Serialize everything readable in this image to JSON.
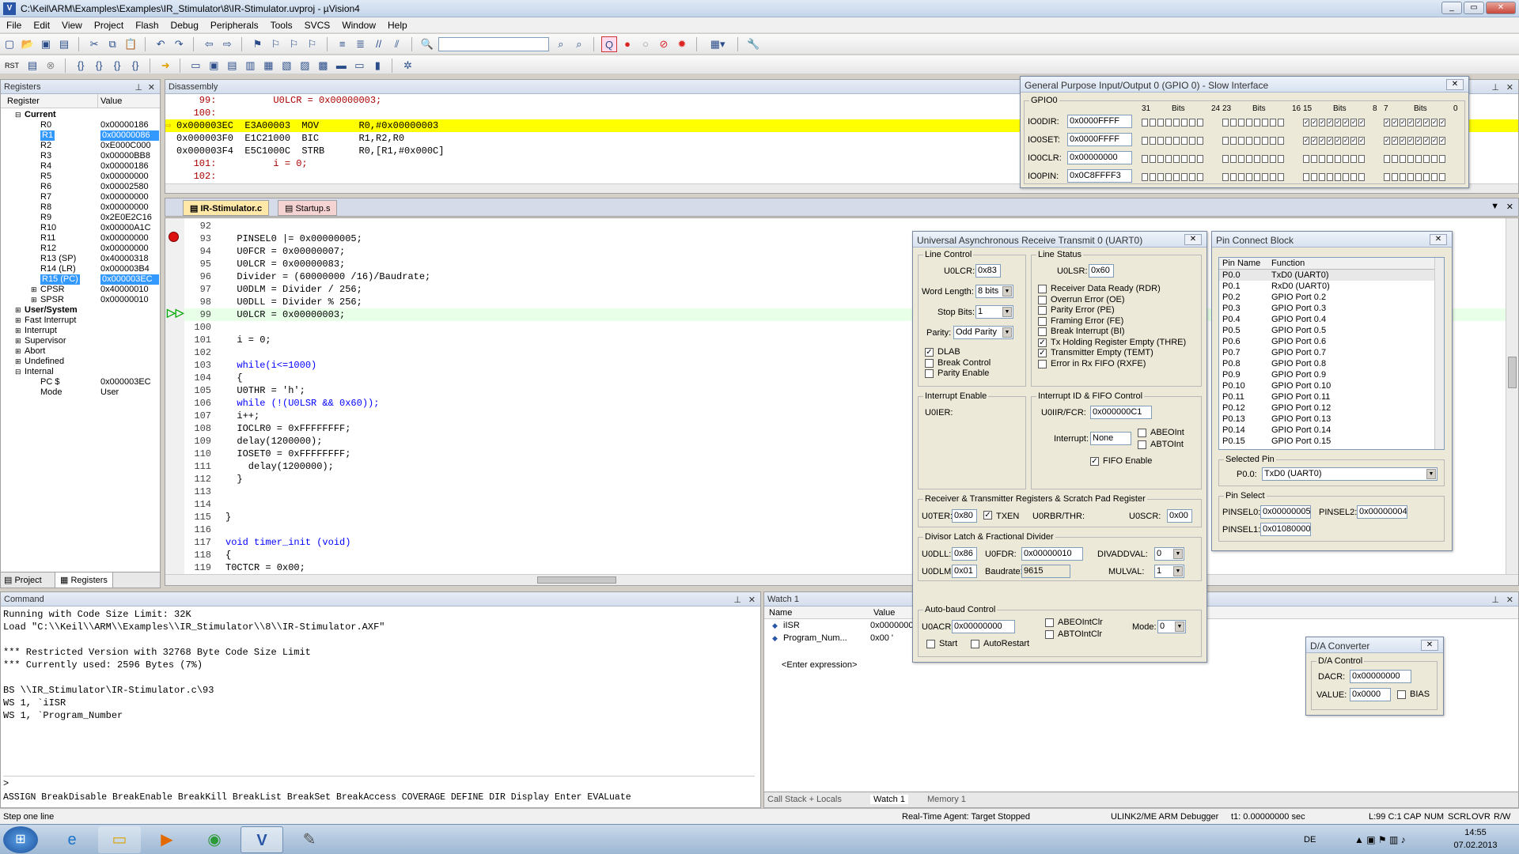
{
  "window": {
    "title": "C:\\Keil\\ARM\\Examples\\Examples\\IR_Stimulator\\8\\IR-Stimulator.uvproj - µVision4",
    "minimize": "_",
    "restore": "▭",
    "close": "✕"
  },
  "menu": [
    "File",
    "Edit",
    "View",
    "Project",
    "Flash",
    "Debug",
    "Peripherals",
    "Tools",
    "SVCS",
    "Window",
    "Help"
  ],
  "registers": {
    "title": "Registers",
    "col_register": "Register",
    "col_value": "Value",
    "current": "Current",
    "items": [
      {
        "n": "R0",
        "v": "0x00000186"
      },
      {
        "n": "R1",
        "v": "0x00000086"
      },
      {
        "n": "R2",
        "v": "0xE000C000"
      },
      {
        "n": "R3",
        "v": "0x00000BB8"
      },
      {
        "n": "R4",
        "v": "0x00000186"
      },
      {
        "n": "R5",
        "v": "0x00000000"
      },
      {
        "n": "R6",
        "v": "0x00002580"
      },
      {
        "n": "R7",
        "v": "0x00000000"
      },
      {
        "n": "R8",
        "v": "0x00000000"
      },
      {
        "n": "R9",
        "v": "0x2E0E2C16"
      },
      {
        "n": "R10",
        "v": "0x00000A1C"
      },
      {
        "n": "R11",
        "v": "0x00000000"
      },
      {
        "n": "R12",
        "v": "0x00000000"
      },
      {
        "n": "R13 (SP)",
        "v": "0x40000318"
      },
      {
        "n": "R14 (LR)",
        "v": "0x000003B4"
      },
      {
        "n": "R15 (PC)",
        "v": "0x000003EC"
      },
      {
        "n": "CPSR",
        "v": "0x40000010"
      },
      {
        "n": "SPSR",
        "v": "0x00000010"
      }
    ],
    "user_system": "User/System",
    "modes": [
      "Fast Interrupt",
      "Interrupt",
      "Supervisor",
      "Abort",
      "Undefined"
    ],
    "internal": "Internal",
    "pc_label": "PC  $",
    "pc_value": "0x000003EC",
    "mode_label": "Mode",
    "mode_value": "User",
    "tab_project": "Project",
    "tab_registers": "Registers"
  },
  "disassembly": {
    "title": "Disassembly",
    "lines": [
      "    99:          U0LCR = 0x00000003;",
      "   100:",
      "0x000003EC  E3A00003  MOV       R0,#0x00000003",
      "0x000003F0  E1C21000  BIC       R1,R2,R0",
      "0x000003F4  E5C1000C  STRB      R0,[R1,#0x000C]",
      "   101:          i = 0;",
      "   102:"
    ]
  },
  "editor": {
    "tabs": [
      "IR-Stimulator.c",
      "Startup.s"
    ],
    "lines": [
      {
        "n": "92",
        "c": ""
      },
      {
        "n": "93",
        "c": "  PINSEL0 |= 0x00000005;"
      },
      {
        "n": "94",
        "c": "  U0FCR = 0x00000007;"
      },
      {
        "n": "95",
        "c": "  U0LCR = 0x00000083;"
      },
      {
        "n": "96",
        "c": "  Divider = (60000000 /16)/Baudrate;"
      },
      {
        "n": "97",
        "c": "  U0DLM = Divider / 256;"
      },
      {
        "n": "98",
        "c": "  U0DLL = Divider % 256;"
      },
      {
        "n": "99",
        "c": "  U0LCR = 0x00000003;"
      },
      {
        "n": "100",
        "c": ""
      },
      {
        "n": "101",
        "c": "  i = 0;"
      },
      {
        "n": "102",
        "c": ""
      },
      {
        "n": "103",
        "c": "  while(i<=1000)"
      },
      {
        "n": "104",
        "c": "  {"
      },
      {
        "n": "105",
        "c": "  U0THR = 'h';"
      },
      {
        "n": "106",
        "c": "  while (!(U0LSR && 0x60));"
      },
      {
        "n": "107",
        "c": "  i++;"
      },
      {
        "n": "108",
        "c": "  IOCLR0 = 0xFFFFFFFF;"
      },
      {
        "n": "109",
        "c": "  delay(1200000);"
      },
      {
        "n": "110",
        "c": "  IOSET0 = 0xFFFFFFFF;"
      },
      {
        "n": "111",
        "c": "    delay(1200000);"
      },
      {
        "n": "112",
        "c": "  }"
      },
      {
        "n": "113",
        "c": ""
      },
      {
        "n": "114",
        "c": ""
      },
      {
        "n": "115",
        "c": "}"
      },
      {
        "n": "116",
        "c": ""
      },
      {
        "n": "117",
        "c": "void timer_init (void)"
      },
      {
        "n": "118",
        "c": "{"
      },
      {
        "n": "119",
        "c": "T0CTCR = 0x00;"
      }
    ]
  },
  "command": {
    "title": "Command",
    "lines": [
      "Running with Code Size Limit: 32K",
      "Load \"C:\\\\Keil\\\\ARM\\\\Examples\\\\IR_Stimulator\\\\8\\\\IR-Stimulator.AXF\"",
      "",
      "*** Restricted Version with 32768 Byte Code Size Limit",
      "*** Currently used: 2596 Bytes (7%)",
      "",
      "BS \\\\IR_Stimulator\\IR-Stimulator.c\\93",
      "WS 1, `iISR",
      "WS 1, `Program_Number"
    ],
    "prompt": ">",
    "help": "ASSIGN BreakDisable BreakEnable BreakKill BreakList BreakSet BreakAccess COVERAGE DEFINE DIR Display Enter EVALuate"
  },
  "watch": {
    "title": "Watch 1",
    "col_name": "Name",
    "col_value": "Value",
    "rows": [
      {
        "n": "iISR",
        "v": "0x0000000"
      },
      {
        "n": "Program_Num...",
        "v": "0x00 '"
      }
    ],
    "enter": "<Enter expression>",
    "tabs": [
      "Call Stack + Locals",
      "Watch 1",
      "Memory 1"
    ]
  },
  "gpio": {
    "title": "General Purpose Input/Output 0 (GPIO 0) - Slow Interface",
    "group": "GPIO0",
    "bits_label": "Bits",
    "bit_marks": [
      "31",
      "24",
      "23",
      "16",
      "15",
      "8",
      "7",
      "0"
    ],
    "rows": [
      {
        "l": "IO0DIR:",
        "v": "0x0000FFFF",
        "hi": 0,
        "lo": 16
      },
      {
        "l": "IO0SET:",
        "v": "0x0000FFFF",
        "hi": 0,
        "lo": 16
      },
      {
        "l": "IO0CLR:",
        "v": "0x00000000",
        "hi": 0,
        "lo": 0
      },
      {
        "l": "IO0PIN:",
        "v": "0x0C8FFFF3",
        "hi": 0,
        "lo": 0
      }
    ]
  },
  "uart": {
    "title": "Universal Asynchronous Receive Transmit 0 (UART0)",
    "line_control": "Line Control",
    "u0lcr_label": "U0LCR:",
    "u0lcr": "0x83",
    "word_length_label": "Word Length:",
    "word_length": "8 bits",
    "stop_bits_label": "Stop Bits:",
    "stop_bits": "1",
    "parity_label": "Parity:",
    "parity": "Odd Parity",
    "lc_checks": [
      {
        "l": "DLAB",
        "c": true
      },
      {
        "l": "Break Control",
        "c": false
      },
      {
        "l": "Parity Enable",
        "c": false
      }
    ],
    "line_status": "Line Status",
    "u0lsr_label": "U0LSR:",
    "u0lsr": "0x60",
    "ls_checks": [
      {
        "l": "Receiver Data Ready (RDR)",
        "c": false
      },
      {
        "l": "Overrun Error (OE)",
        "c": false
      },
      {
        "l": "Parity Error (PE)",
        "c": false
      },
      {
        "l": "Framing Error (FE)",
        "c": false
      },
      {
        "l": "Break Interrupt (BI)",
        "c": false
      },
      {
        "l": "Tx Holding Register Empty (THRE)",
        "c": true
      },
      {
        "l": "Transmitter Empty (TEMT)",
        "c": true
      },
      {
        "l": "Error in Rx FIFO (RXFE)",
        "c": false
      }
    ],
    "interrupt_enable": "Interrupt Enable",
    "u0ier_label": "U0IER:",
    "iid": "Interrupt ID & FIFO Control",
    "u0iir_label": "U0IIR/FCR:",
    "u0iir": "0x000000C1",
    "interrupt_label": "Interrupt:",
    "interrupt": "None",
    "abeoint": "ABEOInt",
    "abtoint": "ABTOInt",
    "fifo_enable": "FIFO Enable",
    "rtsp": "Receiver & Transmitter Registers & Scratch Pad Register",
    "u0ter_label": "U0TER:",
    "u0ter": "0x80",
    "txen": "TXEN",
    "u0rbr_label": "U0RBR/THR:",
    "u0scr_label": "U0SCR:",
    "u0scr": "0x00",
    "divisor": "Divisor Latch & Fractional Divider",
    "u0dll_label": "U0DLL:",
    "u0dll": "0x86",
    "u0fdr_label": "U0FDR:",
    "u0fdr": "0x00000010",
    "divaddval_label": "DIVADDVAL:",
    "divaddval": "0",
    "u0dlm_label": "U0DLM:",
    "u0dlm": "0x01",
    "baudrate_label": "Baudrate:",
    "baudrate": "9615",
    "mulval_label": "MULVAL:",
    "mulval": "1",
    "autobaud": "Auto-baud Control",
    "u0acr_label": "U0ACR:",
    "u0acr": "0x00000000",
    "abeointclr": "ABEOIntClr",
    "abtointclr": "ABTOIntClr",
    "mode_label": "Mode:",
    "mode": "0",
    "start": "Start",
    "autorestart": "AutoRestart"
  },
  "pcb": {
    "title": "Pin Connect Block",
    "col_pin": "Pin Name",
    "col_function": "Function",
    "pins": [
      {
        "p": "P0.0",
        "f": "TxD0 (UART0)"
      },
      {
        "p": "P0.1",
        "f": "RxD0 (UART0)"
      },
      {
        "p": "P0.2",
        "f": "GPIO Port 0.2"
      },
      {
        "p": "P0.3",
        "f": "GPIO Port 0.3"
      },
      {
        "p": "P0.4",
        "f": "GPIO Port 0.4"
      },
      {
        "p": "P0.5",
        "f": "GPIO Port 0.5"
      },
      {
        "p": "P0.6",
        "f": "GPIO Port 0.6"
      },
      {
        "p": "P0.7",
        "f": "GPIO Port 0.7"
      },
      {
        "p": "P0.8",
        "f": "GPIO Port 0.8"
      },
      {
        "p": "P0.9",
        "f": "GPIO Port 0.9"
      },
      {
        "p": "P0.10",
        "f": "GPIO Port 0.10"
      },
      {
        "p": "P0.11",
        "f": "GPIO Port 0.11"
      },
      {
        "p": "P0.12",
        "f": "GPIO Port 0.12"
      },
      {
        "p": "P0.13",
        "f": "GPIO Port 0.13"
      },
      {
        "p": "P0.14",
        "f": "GPIO Port 0.14"
      },
      {
        "p": "P0.15",
        "f": "GPIO Port 0.15"
      }
    ],
    "selected_pin": "Selected Pin",
    "sel_label": "P0.0:",
    "sel_value": "TxD0 (UART0)",
    "pin_select": "Pin Select",
    "pinsel0_label": "PINSEL0:",
    "pinsel0": "0x00000005",
    "pinsel2_label": "PINSEL2:",
    "pinsel2": "0x00000004",
    "pinsel1_label": "PINSEL1:",
    "pinsel1": "0x01080000"
  },
  "dac": {
    "title": "D/A Converter",
    "group": "D/A Control",
    "dacr_label": "DACR:",
    "dacr": "0x00000000",
    "value_label": "VALUE:",
    "value": "0x0000",
    "bias": "BIAS"
  },
  "status": {
    "left": "Step one line",
    "agent": "Real-Time Agent: Target Stopped",
    "debugger": "ULINK2/ME ARM Debugger",
    "time": "t1: 0.00000000 sec",
    "pos": "L:99 C:1",
    "caps": "CAP",
    "num": "NUM",
    "scrl": "SCRL",
    "ovr": "OVR",
    "rw": "R/W"
  },
  "tray": {
    "lang": "DE",
    "time": "14:55",
    "date": "07.02.2013"
  },
  "colors": {
    "highlight": "#ffff00",
    "selection": "#3399ff",
    "keyword": "#0000ff",
    "number": "#800080"
  }
}
